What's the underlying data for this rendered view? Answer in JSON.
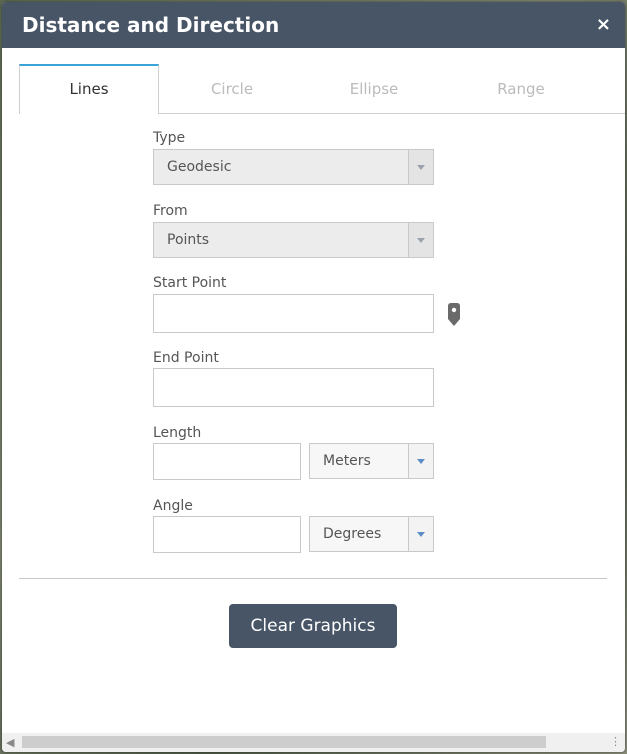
{
  "dialog": {
    "title": "Distance and Direction",
    "close_icon": "×"
  },
  "tabs": [
    {
      "label": "Lines",
      "active": true
    },
    {
      "label": "Circle",
      "active": false
    },
    {
      "label": "Ellipse",
      "active": false
    },
    {
      "label": "Range",
      "active": false
    }
  ],
  "form": {
    "type": {
      "label": "Type",
      "value": "Geodesic"
    },
    "from": {
      "label": "From",
      "value": "Points"
    },
    "start_point": {
      "label": "Start Point",
      "value": ""
    },
    "end_point": {
      "label": "End Point",
      "value": ""
    },
    "length": {
      "label": "Length",
      "value": "",
      "unit": "Meters"
    },
    "angle": {
      "label": "Angle",
      "value": "",
      "unit": "Degrees"
    }
  },
  "actions": {
    "clear_label": "Clear Graphics"
  },
  "icons": {
    "pin": "map-pin-icon",
    "close": "close-icon",
    "dropdown": "chevron-down-icon"
  },
  "colors": {
    "titlebar": "#485566",
    "tab_accent": "#3aa4d8",
    "button": "#485566"
  }
}
